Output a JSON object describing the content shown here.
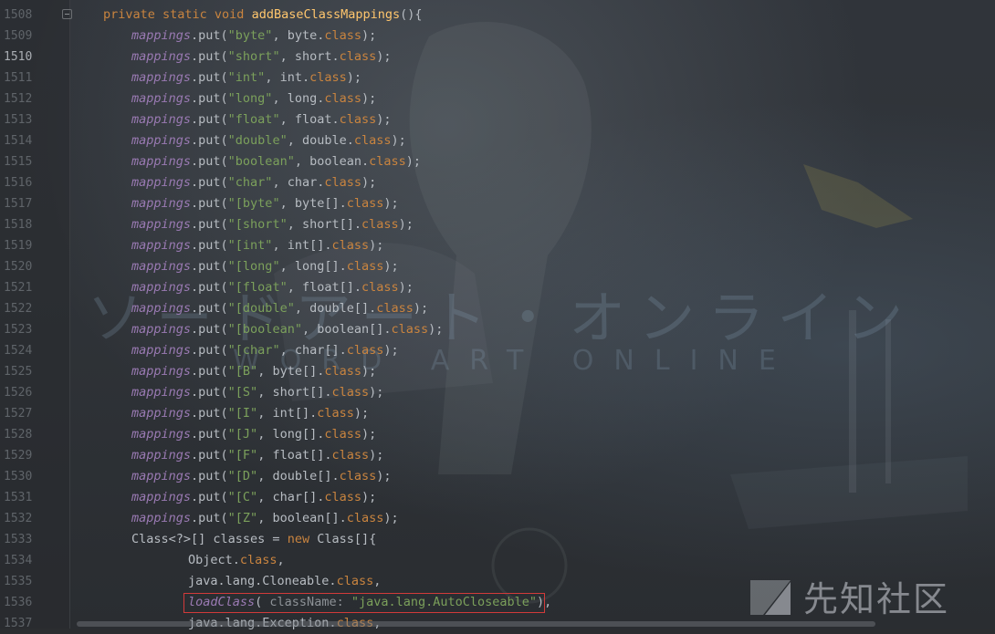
{
  "editor": {
    "current_line": "1510",
    "lines": [
      {
        "n": "1508",
        "parts": [
          [
            "kw",
            "private static void "
          ],
          [
            "method",
            "addBaseClassMappings"
          ],
          [
            "plain",
            "(){"
          ]
        ],
        "indent": 113
      },
      {
        "n": "1509",
        "parts": [
          [
            "ital",
            "mappings"
          ],
          [
            "plain",
            ".put("
          ],
          [
            "str",
            "\"byte\""
          ],
          [
            "plain",
            ", byte."
          ],
          [
            "kw",
            "class"
          ],
          [
            "plain",
            ");"
          ]
        ],
        "indent": 144
      },
      {
        "n": "1510",
        "parts": [
          [
            "ital",
            "mappings"
          ],
          [
            "plain",
            ".put("
          ],
          [
            "str",
            "\"short\""
          ],
          [
            "plain",
            ", short."
          ],
          [
            "kw",
            "class"
          ],
          [
            "plain",
            ");"
          ]
        ],
        "indent": 144
      },
      {
        "n": "1511",
        "parts": [
          [
            "ital",
            "mappings"
          ],
          [
            "plain",
            ".put("
          ],
          [
            "str",
            "\"int\""
          ],
          [
            "plain",
            ", int."
          ],
          [
            "kw",
            "class"
          ],
          [
            "plain",
            ");"
          ]
        ],
        "indent": 144
      },
      {
        "n": "1512",
        "parts": [
          [
            "ital",
            "mappings"
          ],
          [
            "plain",
            ".put("
          ],
          [
            "str",
            "\"long\""
          ],
          [
            "plain",
            ", long."
          ],
          [
            "kw",
            "class"
          ],
          [
            "plain",
            ");"
          ]
        ],
        "indent": 144
      },
      {
        "n": "1513",
        "parts": [
          [
            "ital",
            "mappings"
          ],
          [
            "plain",
            ".put("
          ],
          [
            "str",
            "\"float\""
          ],
          [
            "plain",
            ", float."
          ],
          [
            "kw",
            "class"
          ],
          [
            "plain",
            ");"
          ]
        ],
        "indent": 144
      },
      {
        "n": "1514",
        "parts": [
          [
            "ital",
            "mappings"
          ],
          [
            "plain",
            ".put("
          ],
          [
            "str",
            "\"double\""
          ],
          [
            "plain",
            ", double."
          ],
          [
            "kw",
            "class"
          ],
          [
            "plain",
            ");"
          ]
        ],
        "indent": 144
      },
      {
        "n": "1515",
        "parts": [
          [
            "ital",
            "mappings"
          ],
          [
            "plain",
            ".put("
          ],
          [
            "str",
            "\"boolean\""
          ],
          [
            "plain",
            ", boolean."
          ],
          [
            "kw",
            "class"
          ],
          [
            "plain",
            ");"
          ]
        ],
        "indent": 144
      },
      {
        "n": "1516",
        "parts": [
          [
            "ital",
            "mappings"
          ],
          [
            "plain",
            ".put("
          ],
          [
            "str",
            "\"char\""
          ],
          [
            "plain",
            ", char."
          ],
          [
            "kw",
            "class"
          ],
          [
            "plain",
            ");"
          ]
        ],
        "indent": 144
      },
      {
        "n": "1517",
        "parts": [
          [
            "ital",
            "mappings"
          ],
          [
            "plain",
            ".put("
          ],
          [
            "str",
            "\"[byte\""
          ],
          [
            "plain",
            ", byte[]."
          ],
          [
            "kw",
            "class"
          ],
          [
            "plain",
            ");"
          ]
        ],
        "indent": 144
      },
      {
        "n": "1518",
        "parts": [
          [
            "ital",
            "mappings"
          ],
          [
            "plain",
            ".put("
          ],
          [
            "str",
            "\"[short\""
          ],
          [
            "plain",
            ", short[]."
          ],
          [
            "kw",
            "class"
          ],
          [
            "plain",
            ");"
          ]
        ],
        "indent": 144
      },
      {
        "n": "1519",
        "parts": [
          [
            "ital",
            "mappings"
          ],
          [
            "plain",
            ".put("
          ],
          [
            "str",
            "\"[int\""
          ],
          [
            "plain",
            ", int[]."
          ],
          [
            "kw",
            "class"
          ],
          [
            "plain",
            ");"
          ]
        ],
        "indent": 144
      },
      {
        "n": "1520",
        "parts": [
          [
            "ital",
            "mappings"
          ],
          [
            "plain",
            ".put("
          ],
          [
            "str",
            "\"[long\""
          ],
          [
            "plain",
            ", long[]."
          ],
          [
            "kw",
            "class"
          ],
          [
            "plain",
            ");"
          ]
        ],
        "indent": 144
      },
      {
        "n": "1521",
        "parts": [
          [
            "ital",
            "mappings"
          ],
          [
            "plain",
            ".put("
          ],
          [
            "str",
            "\"[float\""
          ],
          [
            "plain",
            ", float[]."
          ],
          [
            "kw",
            "class"
          ],
          [
            "plain",
            ");"
          ]
        ],
        "indent": 144
      },
      {
        "n": "1522",
        "parts": [
          [
            "ital",
            "mappings"
          ],
          [
            "plain",
            ".put("
          ],
          [
            "str",
            "\"[double\""
          ],
          [
            "plain",
            ", double[]."
          ],
          [
            "kw",
            "class"
          ],
          [
            "plain",
            ");"
          ]
        ],
        "indent": 144
      },
      {
        "n": "1523",
        "parts": [
          [
            "ital",
            "mappings"
          ],
          [
            "plain",
            ".put("
          ],
          [
            "str",
            "\"[boolean\""
          ],
          [
            "plain",
            ", boolean[]."
          ],
          [
            "kw",
            "class"
          ],
          [
            "plain",
            ");"
          ]
        ],
        "indent": 144
      },
      {
        "n": "1524",
        "parts": [
          [
            "ital",
            "mappings"
          ],
          [
            "plain",
            ".put("
          ],
          [
            "str",
            "\"[char\""
          ],
          [
            "plain",
            ", char[]."
          ],
          [
            "kw",
            "class"
          ],
          [
            "plain",
            ");"
          ]
        ],
        "indent": 144
      },
      {
        "n": "1525",
        "parts": [
          [
            "ital",
            "mappings"
          ],
          [
            "plain",
            ".put("
          ],
          [
            "str",
            "\"[B\""
          ],
          [
            "plain",
            ", byte[]."
          ],
          [
            "kw",
            "class"
          ],
          [
            "plain",
            ");"
          ]
        ],
        "indent": 144
      },
      {
        "n": "1526",
        "parts": [
          [
            "ital",
            "mappings"
          ],
          [
            "plain",
            ".put("
          ],
          [
            "str",
            "\"[S\""
          ],
          [
            "plain",
            ", short[]."
          ],
          [
            "kw",
            "class"
          ],
          [
            "plain",
            ");"
          ]
        ],
        "indent": 144
      },
      {
        "n": "1527",
        "parts": [
          [
            "ital",
            "mappings"
          ],
          [
            "plain",
            ".put("
          ],
          [
            "str",
            "\"[I\""
          ],
          [
            "plain",
            ", int[]."
          ],
          [
            "kw",
            "class"
          ],
          [
            "plain",
            ");"
          ]
        ],
        "indent": 144
      },
      {
        "n": "1528",
        "parts": [
          [
            "ital",
            "mappings"
          ],
          [
            "plain",
            ".put("
          ],
          [
            "str",
            "\"[J\""
          ],
          [
            "plain",
            ", long[]."
          ],
          [
            "kw",
            "class"
          ],
          [
            "plain",
            ");"
          ]
        ],
        "indent": 144
      },
      {
        "n": "1529",
        "parts": [
          [
            "ital",
            "mappings"
          ],
          [
            "plain",
            ".put("
          ],
          [
            "str",
            "\"[F\""
          ],
          [
            "plain",
            ", float[]."
          ],
          [
            "kw",
            "class"
          ],
          [
            "plain",
            ");"
          ]
        ],
        "indent": 144
      },
      {
        "n": "1530",
        "parts": [
          [
            "ital",
            "mappings"
          ],
          [
            "plain",
            ".put("
          ],
          [
            "str",
            "\"[D\""
          ],
          [
            "plain",
            ", double[]."
          ],
          [
            "kw",
            "class"
          ],
          [
            "plain",
            ");"
          ]
        ],
        "indent": 144
      },
      {
        "n": "1531",
        "parts": [
          [
            "ital",
            "mappings"
          ],
          [
            "plain",
            ".put("
          ],
          [
            "str",
            "\"[C\""
          ],
          [
            "plain",
            ", char[]."
          ],
          [
            "kw",
            "class"
          ],
          [
            "plain",
            ");"
          ]
        ],
        "indent": 144
      },
      {
        "n": "1532",
        "parts": [
          [
            "ital",
            "mappings"
          ],
          [
            "plain",
            ".put("
          ],
          [
            "str",
            "\"[Z\""
          ],
          [
            "plain",
            ", boolean[]."
          ],
          [
            "kw",
            "class"
          ],
          [
            "plain",
            ");"
          ]
        ],
        "indent": 144
      },
      {
        "n": "1533",
        "parts": [
          [
            "plain",
            "Class<?>[] classes = "
          ],
          [
            "kw",
            "new "
          ],
          [
            "plain",
            "Class[]{"
          ]
        ],
        "indent": 144
      },
      {
        "n": "1534",
        "parts": [
          [
            "plain",
            "Object."
          ],
          [
            "kw",
            "class"
          ],
          [
            "plain",
            ","
          ]
        ],
        "indent": 206
      },
      {
        "n": "1535",
        "parts": [
          [
            "plain",
            "java.lang.Cloneable."
          ],
          [
            "kw",
            "class"
          ],
          [
            "plain",
            ","
          ]
        ],
        "indent": 206
      },
      {
        "n": "1536",
        "parts": [
          [
            "ital",
            "loadClass"
          ],
          [
            "plain",
            "( "
          ],
          [
            "gray",
            "className: "
          ],
          [
            "str",
            "\"java.lang.AutoCloseable\""
          ],
          [
            "plain",
            "),"
          ]
        ],
        "indent": 206
      },
      {
        "n": "1537",
        "parts": [
          [
            "plain",
            "java.lang.Exception."
          ],
          [
            "kw",
            "class"
          ],
          [
            "plain",
            ","
          ]
        ],
        "indent": 206
      }
    ]
  },
  "background_art": {
    "katakana": "ソードアート・オンライン",
    "latin": "WORD ART ONLINE"
  },
  "watermark": {
    "text": "先知社区",
    "logo": "xianzhi-logo-icon"
  },
  "colors": {
    "keyword": "#c9843f",
    "field_italic": "#9a7ab3",
    "string": "#7ba05b",
    "plain": "#b7bcc2",
    "highlight_border": "#d23a3a"
  }
}
